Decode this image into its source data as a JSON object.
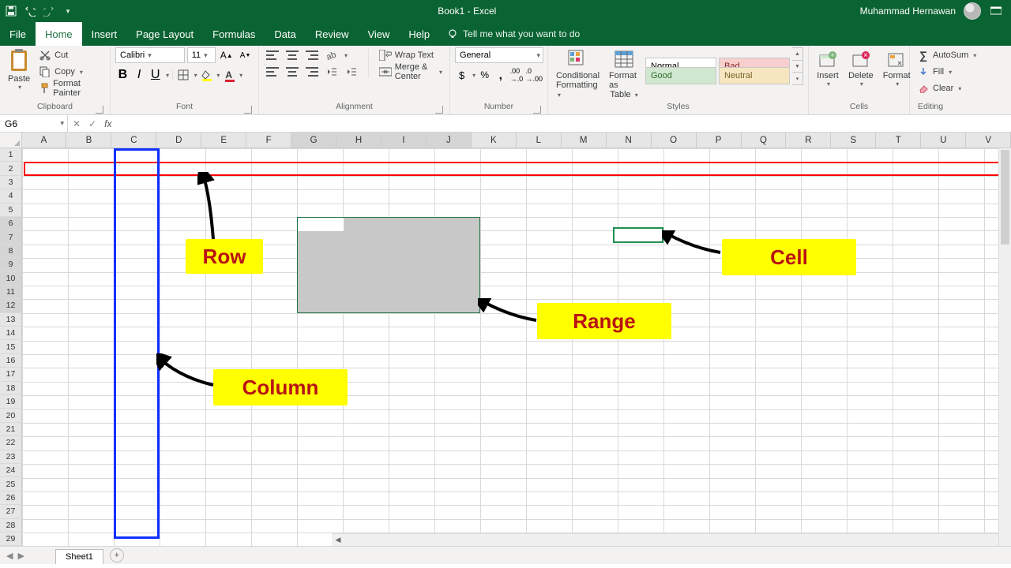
{
  "title": "Book1 - Excel",
  "user": "Muhammad Hernawan",
  "tabs": [
    "File",
    "Home",
    "Insert",
    "Page Layout",
    "Formulas",
    "Data",
    "Review",
    "View",
    "Help"
  ],
  "active_tab": 1,
  "tellme": "Tell me what you want to do",
  "clipboard": {
    "paste": "Paste",
    "cut": "Cut",
    "copy": "Copy",
    "painter": "Format Painter",
    "label": "Clipboard"
  },
  "font": {
    "name": "Calibri",
    "size": "11",
    "b": "B",
    "i": "I",
    "u": "U",
    "label": "Font"
  },
  "alignment": {
    "wrap": "Wrap Text",
    "merge": "Merge & Center",
    "label": "Alignment"
  },
  "number": {
    "format": "General",
    "label": "Number"
  },
  "styles": {
    "cond": "Conditional",
    "cond2": "Formatting",
    "fat": "Format as",
    "fat2": "Table",
    "normal": "Normal",
    "bad": "Bad",
    "good": "Good",
    "neutral": "Neutral",
    "label": "Styles"
  },
  "cells": {
    "insert": "Insert",
    "delete": "Delete",
    "format": "Format",
    "label": "Cells"
  },
  "editing": {
    "sum": "AutoSum",
    "fill": "Fill",
    "clear": "Clear",
    "label": "Editing"
  },
  "namebox": "G6",
  "columns": [
    "A",
    "B",
    "C",
    "D",
    "E",
    "F",
    "G",
    "H",
    "I",
    "J",
    "K",
    "L",
    "M",
    "N",
    "O",
    "P",
    "Q",
    "R",
    "S",
    "T",
    "U",
    "V"
  ],
  "sel_cols": [
    "G",
    "H",
    "I",
    "J"
  ],
  "rows": 29,
  "sel_rows": [
    6,
    7,
    8,
    9,
    10,
    11,
    12
  ],
  "sheet": "Sheet1",
  "callouts": {
    "row": "Row",
    "column": "Column",
    "range": "Range",
    "cell": "Cell"
  }
}
